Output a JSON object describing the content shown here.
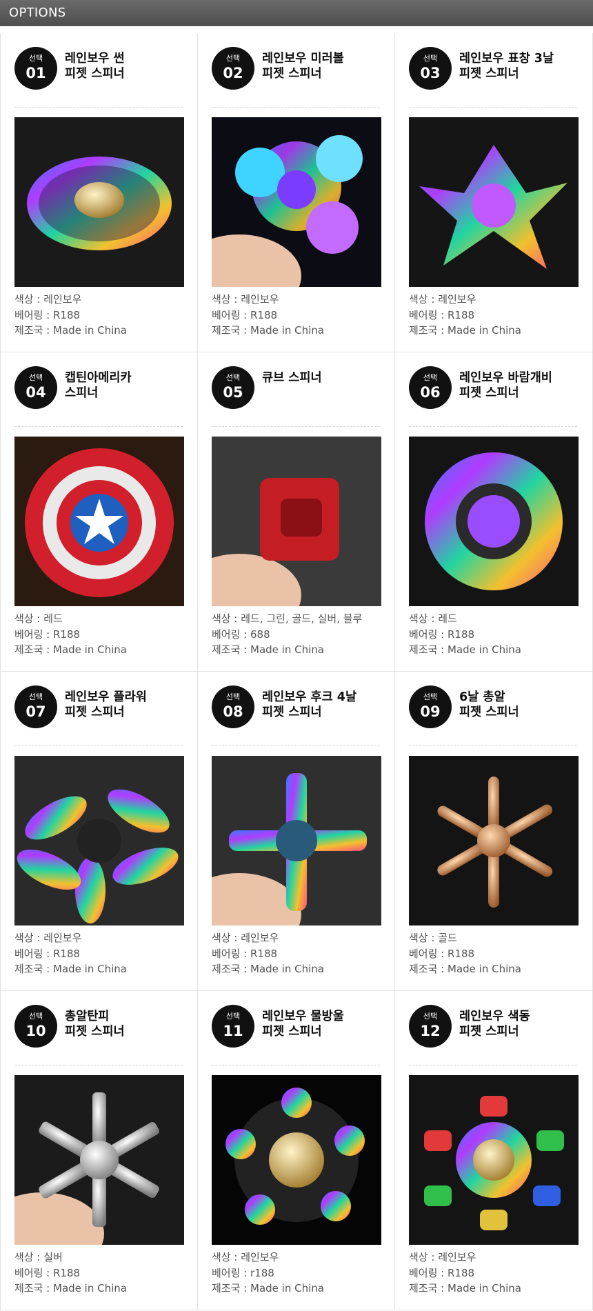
{
  "header": {
    "title": "OPTIONS"
  },
  "select_label": "선택",
  "labels": {
    "color": "색상 : ",
    "bearing": "베어링 : ",
    "origin": "제조국 : "
  },
  "options": [
    {
      "num": "01",
      "title_line1": "레인보우 썬",
      "title_line2": "피젯 스피너",
      "color": "레인보우",
      "bearing": "R188",
      "origin": "Made in China",
      "image": "rainbow-sun-spinner"
    },
    {
      "num": "02",
      "title_line1": "레인보우 미러볼",
      "title_line2": "피젯 스피너",
      "color": "레인보우",
      "bearing": "R188",
      "origin": "Made in China",
      "image": "rainbow-mirrorball-spinner"
    },
    {
      "num": "03",
      "title_line1": "레인보우 표창 3날",
      "title_line2": "피젯 스피너",
      "color": "레인보우",
      "bearing": "R188",
      "origin": "Made in China",
      "image": "rainbow-shuriken-spinner"
    },
    {
      "num": "04",
      "title_line1": "캡틴아메리카",
      "title_line2": "스피너",
      "color": "레드",
      "bearing": "R188",
      "origin": "Made in China",
      "image": "captain-america-spinner"
    },
    {
      "num": "05",
      "title_line1": "큐브 스피너",
      "title_line2": "",
      "color": "레드, 그린, 골드, 실버, 블루",
      "bearing": "688",
      "origin": "Made in China",
      "image": "cube-spinner"
    },
    {
      "num": "06",
      "title_line1": "레인보우 바람개비",
      "title_line2": "피젯 스피너",
      "color": "레드",
      "bearing": "R188",
      "origin": "Made in China",
      "image": "rainbow-pinwheel-spinner"
    },
    {
      "num": "07",
      "title_line1": "레인보우 플라워",
      "title_line2": "피젯 스피너",
      "color": "레인보우",
      "bearing": "R188",
      "origin": "Made in China",
      "image": "rainbow-flower-spinner"
    },
    {
      "num": "08",
      "title_line1": "레인보우 후크 4날",
      "title_line2": "피젯 스피너",
      "color": "레인보우",
      "bearing": "R188",
      "origin": "Made in China",
      "image": "rainbow-hook-spinner"
    },
    {
      "num": "09",
      "title_line1": "6날 총알",
      "title_line2": "피젯 스피너",
      "color": "골드",
      "bearing": "R188",
      "origin": "Made in China",
      "image": "gold-bullet-spinner"
    },
    {
      "num": "10",
      "title_line1": "총알탄피",
      "title_line2": "피젯 스피너",
      "color": "실버",
      "bearing": "R188",
      "origin": "Made in China",
      "image": "silver-shell-spinner"
    },
    {
      "num": "11",
      "title_line1": "레인보우 물방울",
      "title_line2": "피젯 스피너",
      "color": "레인보우",
      "bearing": "r188",
      "origin": "Made in China",
      "image": "rainbow-droplet-spinner"
    },
    {
      "num": "12",
      "title_line1": "레인보우 색동",
      "title_line2": "피젯 스피너",
      "color": "레인보우",
      "bearing": "R188",
      "origin": "Made in China",
      "image": "rainbow-stripe-spinner"
    }
  ]
}
